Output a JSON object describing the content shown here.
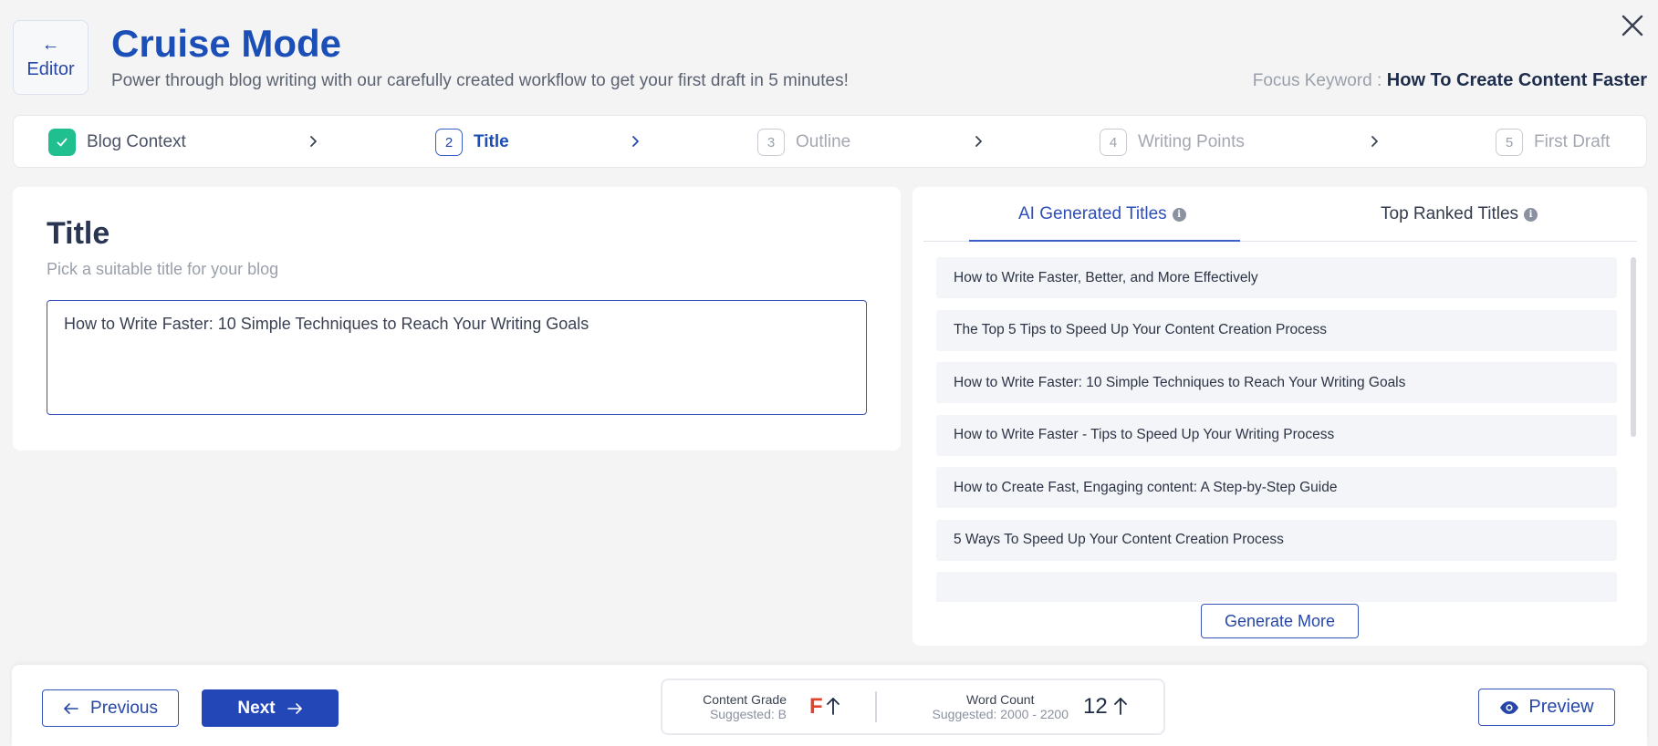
{
  "header": {
    "back_label": "Editor",
    "title": "Cruise Mode",
    "subtitle": "Power through blog writing with our carefully created workflow to get your first draft in 5 minutes!",
    "focus_keyword_label": "Focus Keyword :",
    "focus_keyword_value": "How To Create Content Faster"
  },
  "steps": [
    {
      "num": "1",
      "label": "Blog Context",
      "state": "done"
    },
    {
      "num": "2",
      "label": "Title",
      "state": "active"
    },
    {
      "num": "3",
      "label": "Outline",
      "state": "pending"
    },
    {
      "num": "4",
      "label": "Writing Points",
      "state": "pending"
    },
    {
      "num": "5",
      "label": "First Draft",
      "state": "pending"
    }
  ],
  "title_panel": {
    "heading": "Title",
    "hint": "Pick a suitable title for your blog",
    "value": "How to Write Faster: 10 Simple Techniques to Reach Your Writing Goals"
  },
  "suggestions": {
    "tabs": [
      {
        "label": "AI Generated Titles",
        "active": true
      },
      {
        "label": "Top Ranked Titles",
        "active": false
      }
    ],
    "items": [
      "How to Write Faster, Better, and More Effectively",
      "The Top 5 Tips to Speed Up Your Content Creation Process",
      "How to Write Faster: 10 Simple Techniques to Reach Your Writing Goals",
      "How to Write Faster - Tips to Speed Up Your Writing Process",
      "How to Create Fast, Engaging content: A Step-by-Step Guide",
      "5 Ways To Speed Up Your Content Creation Process",
      ""
    ],
    "generate_more_label": "Generate More"
  },
  "footer": {
    "previous_label": "Previous",
    "next_label": "Next",
    "content_grade_label": "Content Grade",
    "content_grade_suggested": "Suggested: B",
    "content_grade_value": "F",
    "word_count_label": "Word Count",
    "word_count_suggested": "Suggested: 2000 - 2200",
    "word_count_value": "12",
    "preview_label": "Preview"
  },
  "colors": {
    "brand": "#1b4fb7",
    "primary_button": "#2447b8",
    "done_step": "#1fbf8f",
    "grade_bad": "#e0442a"
  },
  "icons": [
    "arrow-left-icon",
    "close-icon",
    "check-icon",
    "chevron-right-icon",
    "info-icon",
    "arrow-right-icon",
    "arrow-up-icon",
    "eye-icon"
  ]
}
